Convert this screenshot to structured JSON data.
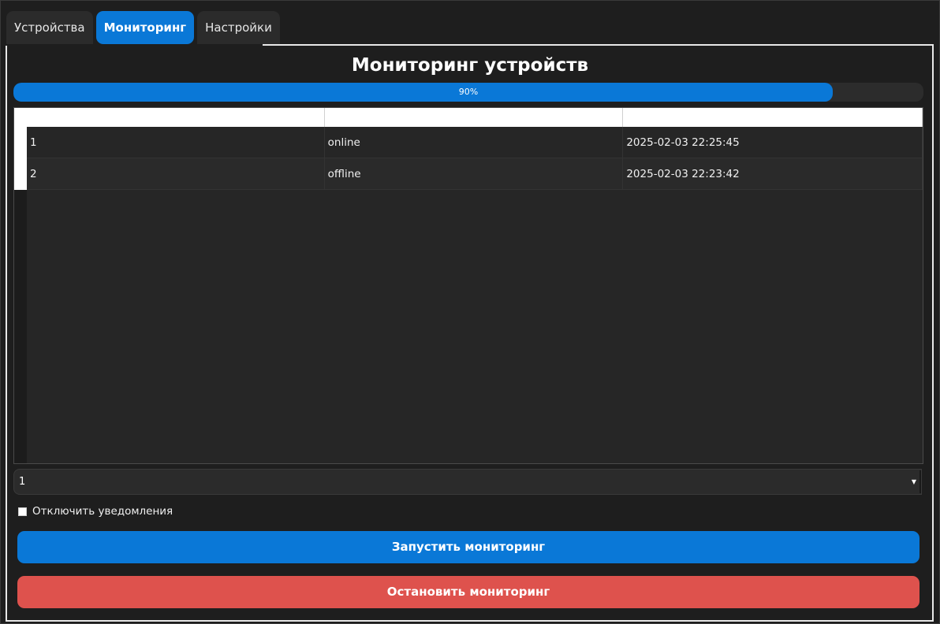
{
  "tabs": [
    {
      "label": "Устройства",
      "active": false
    },
    {
      "label": "Мониторинг",
      "active": true
    },
    {
      "label": "Настройки",
      "active": false
    }
  ],
  "page_title": "Мониторинг устройств",
  "progress": {
    "value": 90,
    "label": "90%"
  },
  "table": {
    "columns": [
      "",
      "",
      ""
    ],
    "rows": [
      [
        "1",
        "online",
        "2025-02-03 22:25:45"
      ],
      [
        "2",
        "offline",
        "2025-02-03 22:23:42"
      ]
    ]
  },
  "device_select": {
    "value": "1"
  },
  "notifications_checkbox": {
    "label": "Отключить уведомления",
    "checked": false
  },
  "buttons": {
    "start_label": "Запустить мониторинг",
    "stop_label": "Остановить мониторинг"
  },
  "colors": {
    "accent": "#0a78d7",
    "danger": "#de524d",
    "background": "#1e1e1e"
  }
}
